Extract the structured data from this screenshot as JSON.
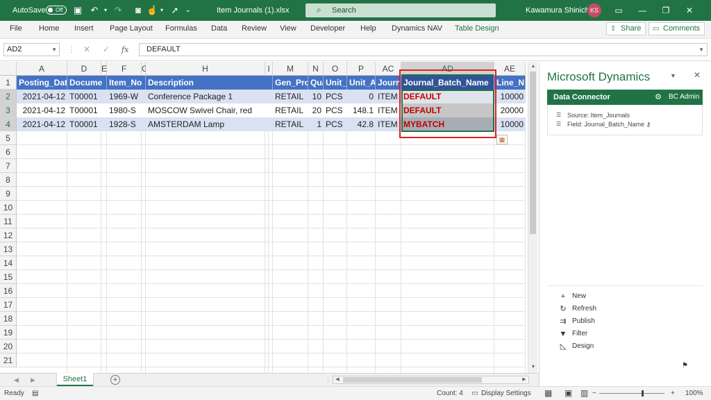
{
  "titlebar": {
    "autosave_label": "AutoSave",
    "autosave_state": "Off",
    "filename": "Item Journals (1).xlsx",
    "search_placeholder": "Search",
    "user_name": "Kawamura Shinichi",
    "user_initials": "KS"
  },
  "ribbon": {
    "tabs": [
      "File",
      "Home",
      "Insert",
      "Page Layout",
      "Formulas",
      "Data",
      "Review",
      "View",
      "Developer",
      "Help",
      "Dynamics NAV",
      "Table Design"
    ],
    "share_label": "Share",
    "comments_label": "Comments"
  },
  "formula_bar": {
    "name_box": "AD2",
    "fx": "fx",
    "content": "DEFAULT"
  },
  "sheet": {
    "columns": [
      "A",
      "D",
      "E",
      "F",
      "G",
      "H",
      "I",
      "M",
      "N",
      "O",
      "P",
      "AC",
      "AD",
      "AE"
    ],
    "selected_column": "AD",
    "rows": [
      "1",
      "2",
      "3",
      "4",
      "5",
      "6",
      "7",
      "8",
      "9",
      "10",
      "11",
      "12",
      "13",
      "14",
      "15",
      "16",
      "17",
      "18",
      "19",
      "20",
      "21"
    ],
    "header_row": [
      "Posting_Dat",
      "Docume",
      "Item_No",
      "Description",
      "Gen_Pro",
      "Qua",
      "Unit_",
      "Unit_A",
      "Journ",
      "Journal_Batch_Name",
      "Line_N"
    ],
    "data_rows": [
      [
        "2021-04-12",
        "T00001",
        "1969-W",
        "Conference Package 1",
        "RETAIL",
        "10",
        "PCS",
        "0",
        "ITEM",
        "DEFAULT",
        "10000"
      ],
      [
        "2021-04-12",
        "T00001",
        "1980-S",
        "MOSCOW Swivel Chair, red",
        "RETAIL",
        "20",
        "PCS",
        "148.1",
        "ITEM",
        "DEFAULT",
        "20000"
      ],
      [
        "2021-04-12",
        "T00001",
        "1928-S",
        "AMSTERDAM Lamp",
        "RETAIL",
        "1",
        "PCS",
        "42.8",
        "ITEM",
        "MYBATCH",
        "10000"
      ]
    ],
    "tab_name": "Sheet1"
  },
  "statusbar": {
    "ready": "Ready",
    "count": "Count: 4",
    "display_settings": "Display Settings",
    "zoom": "100%"
  },
  "pane": {
    "title": "Microsoft Dynamics",
    "connector_title": "Data Connector",
    "user": "BC Admin",
    "source": "Source: Item_Journals",
    "field": "Field: Journal_Batch_Name",
    "actions": [
      "New",
      "Refresh",
      "Publish",
      "Filter",
      "Design"
    ]
  },
  "colors": {
    "excel_green": "#217346",
    "table_header": "#4472c4",
    "band": "#d9e1f2",
    "highlight_red": "#c00000"
  }
}
